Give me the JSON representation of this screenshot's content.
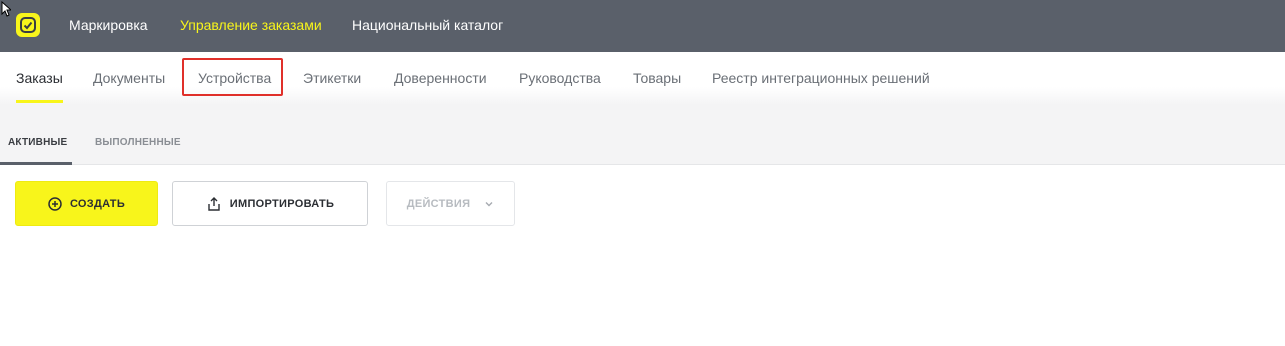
{
  "header": {
    "logo_icon": "logo-icon",
    "nav": [
      {
        "label": "Маркировка",
        "active": false
      },
      {
        "label": "Управление заказами",
        "active": true
      },
      {
        "label": "Национальный каталог",
        "active": false
      }
    ],
    "accent_color": "#f8f51b",
    "background_color": "#5a606a"
  },
  "subnav": {
    "items": [
      {
        "label": "Заказы",
        "active": true
      },
      {
        "label": "Документы",
        "active": false
      },
      {
        "label": "Устройства",
        "active": false,
        "highlighted": true
      },
      {
        "label": "Этикетки",
        "active": false
      },
      {
        "label": "Доверенности",
        "active": false
      },
      {
        "label": "Руководства",
        "active": false
      },
      {
        "label": "Товары",
        "active": false
      },
      {
        "label": "Реестр интеграционных решений",
        "active": false
      }
    ],
    "highlight_color": "#e0302a"
  },
  "tabs": [
    {
      "label": "АКТИВНЫЕ",
      "active": true
    },
    {
      "label": "ВЫПОЛНЕННЫЕ",
      "active": false
    }
  ],
  "toolbar": {
    "create_label": "СОЗДАТЬ",
    "create_icon": "plus-circle-icon",
    "import_label": "ИМПОРТИРОВАТЬ",
    "import_icon": "upload-icon",
    "actions_label": "ДЕЙСТВИЯ",
    "actions_icon": "chevron-down-icon",
    "actions_disabled": true
  }
}
